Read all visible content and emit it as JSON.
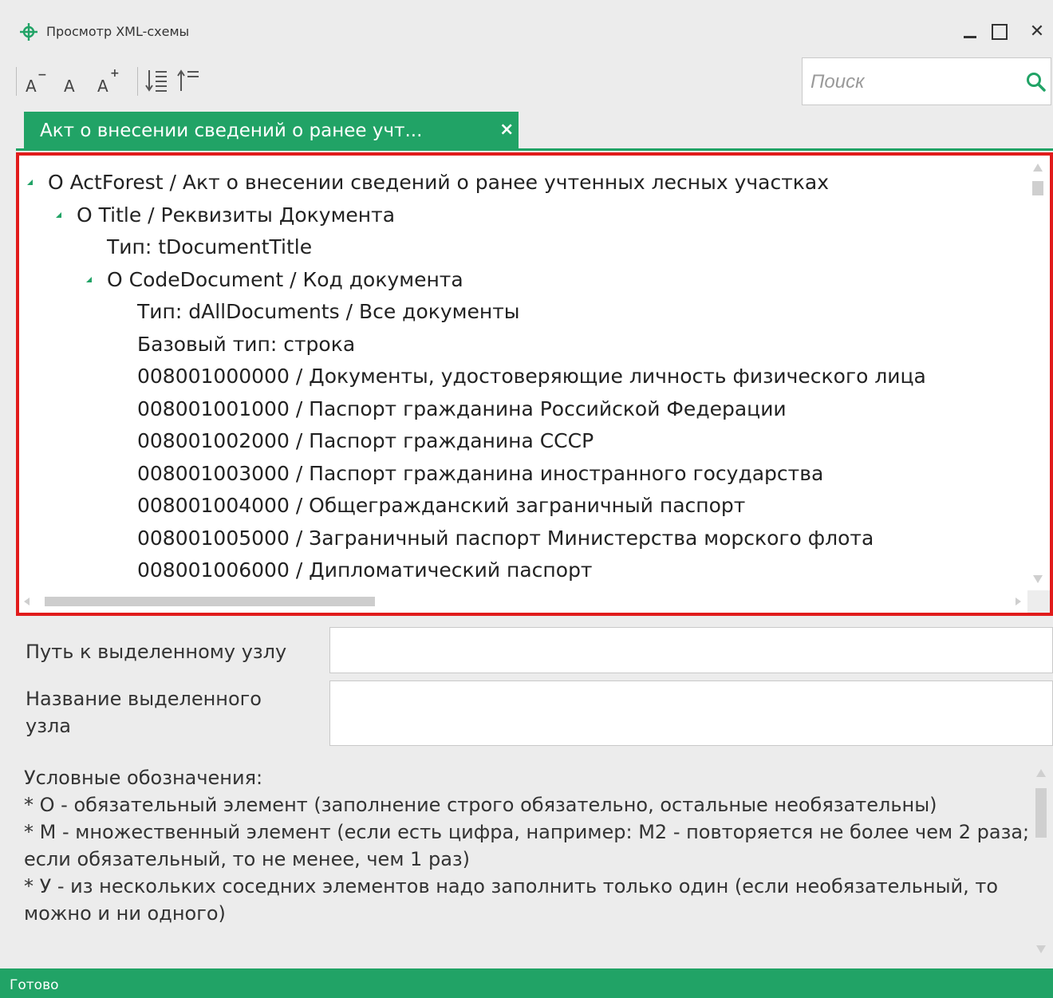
{
  "window": {
    "title": "Просмотр XML-схемы",
    "buttons": {
      "minimize": "minimize-icon",
      "maximize": "maximize-icon",
      "close": "close-icon"
    }
  },
  "toolbar": {
    "font_decrease": "decrease-font-icon",
    "font_normal": "normal-font-icon",
    "font_increase": "increase-font-icon",
    "expand_all": "expand-all-icon",
    "collapse_all": "collapse-all-icon",
    "search_placeholder": "Поиск",
    "search_icon": "search-icon"
  },
  "tab": {
    "label": "Акт о внесении сведений о ранее учт...",
    "close": "×"
  },
  "tree": {
    "rows": [
      {
        "text": "O ActForest / Акт о внесении сведений о ранее учтенных лесных участках",
        "level": 0,
        "expandable": true
      },
      {
        "text": "O Title / Реквизиты Документа",
        "level": 1,
        "expandable": true
      },
      {
        "text": "Тип: tDocumentTitle",
        "level": 2,
        "expandable": false
      },
      {
        "text": "O CodeDocument / Код документа",
        "level": 2,
        "expandable": true
      },
      {
        "text": "Тип: dAllDocuments / Все документы",
        "level": 3,
        "expandable": false
      },
      {
        "text": "Базовый тип: строка",
        "level": 3,
        "expandable": false
      },
      {
        "text": "008001000000 / Документы, удостоверяющие личность физического лица",
        "level": 3,
        "expandable": false
      },
      {
        "text": "008001001000 / Паспорт гражданина Российской Федерации",
        "level": 3,
        "expandable": false
      },
      {
        "text": "008001002000 / Паспорт гражданина СССР",
        "level": 3,
        "expandable": false
      },
      {
        "text": "008001003000 / Паспорт гражданина иностранного государства",
        "level": 3,
        "expandable": false
      },
      {
        "text": "008001004000 / Общегражданский заграничный паспорт",
        "level": 3,
        "expandable": false
      },
      {
        "text": "008001005000 / Заграничный паспорт Министерства морского флота",
        "level": 3,
        "expandable": false
      },
      {
        "text": "008001006000 / Дипломатический паспорт",
        "level": 3,
        "expandable": false
      }
    ]
  },
  "fields": {
    "path_label": "Путь к выделенному узлу",
    "path_value": "",
    "name_label": "Название выделенного узла",
    "name_value": ""
  },
  "legend": {
    "title": "Условные обозначения:",
    "items": [
      "* О - обязательный элемент (заполнение строго обязательно, остальные необязательны)",
      "* М - множественный элемент (если есть цифра, например: М2 - повторяется не более чем 2 раза; если обязательный, то не менее, чем 1 раз)",
      "* У - из нескольких соседних элементов надо заполнить только один (если необязательный, то можно и ни одного)"
    ]
  },
  "status": {
    "text": "Готово"
  },
  "colors": {
    "accent": "#21a366",
    "highlight_border": "#e11b1b",
    "background": "#ececec"
  }
}
